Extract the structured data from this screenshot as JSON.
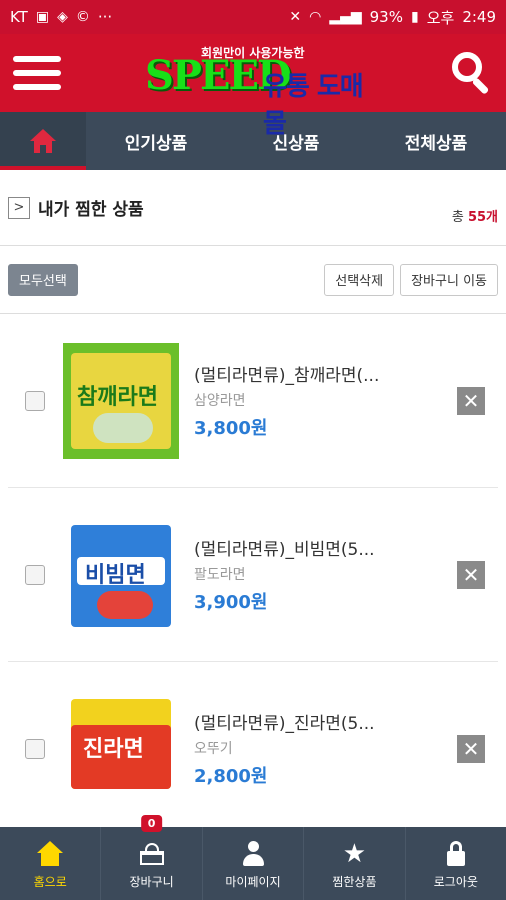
{
  "status_bar": {
    "carrier": "KT",
    "battery": "93%",
    "ampm": "오후",
    "time": "2:49",
    "more": "···"
  },
  "header": {
    "logo_tagline": "회원만이 사용가능한",
    "logo_main": "SPEED",
    "logo_kr": "유통 도매몰"
  },
  "nav": {
    "tabs": [
      "인기상품",
      "신상품",
      "전체상품"
    ]
  },
  "wishlist": {
    "title": "내가 찜한 상품",
    "count_prefix": "총",
    "count": "55",
    "count_suffix": "개"
  },
  "toolbar": {
    "select_all": "모두선택",
    "delete_selected": "선택삭제",
    "move_to_cart": "장바구니 이동"
  },
  "products": [
    {
      "name": "(멀티라면류)_참깨라면(...",
      "brand": "삼양라면",
      "price": "3,800원",
      "pkg_label": "참깨라면"
    },
    {
      "name": "(멀티라면류)_비빔면(5...",
      "brand": "팔도라면",
      "price": "3,900원",
      "pkg_label": "비빔면"
    },
    {
      "name": "(멀티라면류)_진라면(5...",
      "brand": "오뚜기",
      "price": "2,800원",
      "pkg_label": "진라면"
    }
  ],
  "bottom_tabs": {
    "home": "홈으로",
    "cart": "장바구니",
    "cart_badge": "0",
    "mypage": "마이페이지",
    "wish": "찜한상품",
    "logout": "로그아웃"
  },
  "colors": {
    "brand_red": "#d0112b",
    "nav_dark": "#3c4a5a",
    "price_blue": "#2a7bd4",
    "active_yellow": "#ffd800"
  }
}
